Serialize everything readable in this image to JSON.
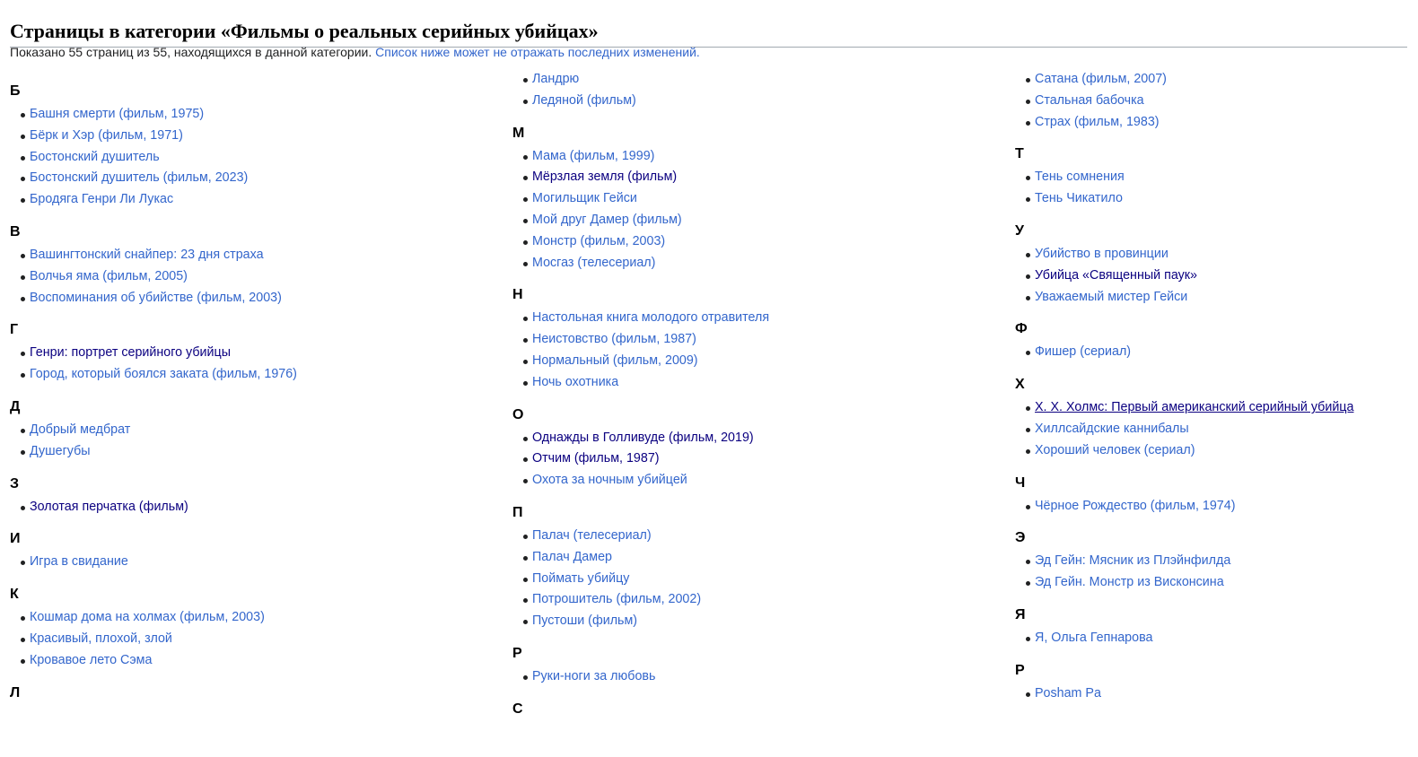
{
  "page": {
    "heading": "Страницы в категории «Фильмы о реальных серийных убийцах»",
    "summary_text": "Показано 55 страниц из 55, находящихся в данной категории. ",
    "summary_link": "Список ниже может не отражать последних изменений."
  },
  "link_colors": {
    "link": "#3366cc",
    "visited": "#0b0080"
  },
  "columns": [
    {
      "groups": [
        {
          "letter": "Б",
          "items": [
            {
              "label": "Башня смерти (фильм, 1975)"
            },
            {
              "label": "Бёрк и Хэр (фильм, 1971)"
            },
            {
              "label": "Бостонский душитель"
            },
            {
              "label": "Бостонский душитель (фильм, 2023)"
            },
            {
              "label": "Бродяга Генри Ли Лукас"
            }
          ]
        },
        {
          "letter": "В",
          "items": [
            {
              "label": "Вашингтонский снайпер: 23 дня страха"
            },
            {
              "label": "Волчья яма (фильм, 2005)"
            },
            {
              "label": "Воспоминания об убийстве (фильм, 2003)"
            }
          ]
        },
        {
          "letter": "Г",
          "items": [
            {
              "label": "Генри: портрет серийного убийцы",
              "visited": true
            },
            {
              "label": "Город, который боялся заката (фильм, 1976)"
            }
          ]
        },
        {
          "letter": "Д",
          "items": [
            {
              "label": "Добрый медбрат"
            },
            {
              "label": "Душегубы"
            }
          ]
        },
        {
          "letter": "З",
          "items": [
            {
              "label": "Золотая перчатка (фильм)",
              "visited": true
            }
          ]
        },
        {
          "letter": "И",
          "items": [
            {
              "label": "Игра в свидание"
            }
          ]
        },
        {
          "letter": "К",
          "items": [
            {
              "label": "Кошмар дома на холмах (фильм, 2003)"
            },
            {
              "label": "Красивый, плохой, злой"
            },
            {
              "label": "Кровавое лето Сэма"
            }
          ]
        },
        {
          "letter": "Л",
          "items": []
        }
      ]
    },
    {
      "groups": [
        {
          "letter": "",
          "items": [
            {
              "label": "Ландрю"
            },
            {
              "label": "Ледяной (фильм)"
            }
          ]
        },
        {
          "letter": "М",
          "items": [
            {
              "label": "Мама (фильм, 1999)"
            },
            {
              "label": "Мёрзлая земля (фильм)",
              "visited": true
            },
            {
              "label": "Могильщик Гейси"
            },
            {
              "label": "Мой друг Дамер (фильм)"
            },
            {
              "label": "Монстр (фильм, 2003)"
            },
            {
              "label": "Мосгаз (телесериал)"
            }
          ]
        },
        {
          "letter": "Н",
          "items": [
            {
              "label": "Настольная книга молодого отравителя"
            },
            {
              "label": "Неистовство (фильм, 1987)"
            },
            {
              "label": "Нормальный (фильм, 2009)"
            },
            {
              "label": "Ночь охотника"
            }
          ]
        },
        {
          "letter": "О",
          "items": [
            {
              "label": "Однажды в Голливуде (фильм, 2019)",
              "visited": true
            },
            {
              "label": "Отчим (фильм, 1987)",
              "visited": true
            },
            {
              "label": "Охота за ночным убийцей"
            }
          ]
        },
        {
          "letter": "П",
          "items": [
            {
              "label": "Палач (телесериал)"
            },
            {
              "label": "Палач Дамер"
            },
            {
              "label": "Поймать убийцу"
            },
            {
              "label": "Потрошитель (фильм, 2002)"
            },
            {
              "label": "Пустоши (фильм)"
            }
          ]
        },
        {
          "letter": "Р",
          "items": [
            {
              "label": "Руки-ноги за любовь"
            }
          ]
        },
        {
          "letter": "С",
          "items": []
        }
      ]
    },
    {
      "groups": [
        {
          "letter": "",
          "items": [
            {
              "label": "Сатана (фильм, 2007)"
            },
            {
              "label": "Стальная бабочка"
            },
            {
              "label": "Страх (фильм, 1983)"
            }
          ]
        },
        {
          "letter": "Т",
          "items": [
            {
              "label": "Тень сомнения"
            },
            {
              "label": "Тень Чикатило"
            }
          ]
        },
        {
          "letter": "У",
          "items": [
            {
              "label": "Убийство в провинции"
            },
            {
              "label": "Убийца «Священный паук»",
              "visited": true
            },
            {
              "label": "Уважаемый мистер Гейси"
            }
          ]
        },
        {
          "letter": "Ф",
          "items": [
            {
              "label": "Фишер (сериал)"
            }
          ]
        },
        {
          "letter": "Х",
          "items": [
            {
              "label": "Х. Х. Холмс: Первый американский серийный убийца",
              "hovered": true
            },
            {
              "label": "Хиллсайдские каннибалы"
            },
            {
              "label": "Хороший человек (сериал)"
            }
          ]
        },
        {
          "letter": "Ч",
          "items": [
            {
              "label": "Чёрное Рождество (фильм, 1974)"
            }
          ]
        },
        {
          "letter": "Э",
          "items": [
            {
              "label": "Эд Гейн: Мясник из Плэйнфилда"
            },
            {
              "label": "Эд Гейн. Монстр из Висконсина"
            }
          ]
        },
        {
          "letter": "Я",
          "items": [
            {
              "label": "Я, Ольга Гепнарова"
            }
          ]
        },
        {
          "letter": "P",
          "items": [
            {
              "label": "Posham Pa"
            }
          ]
        }
      ]
    }
  ]
}
